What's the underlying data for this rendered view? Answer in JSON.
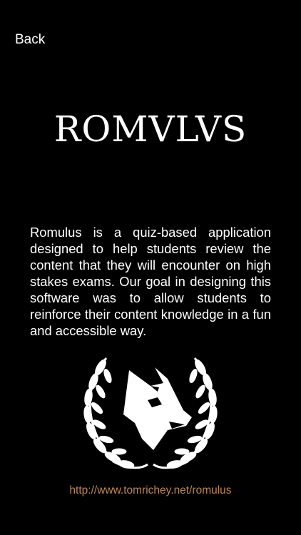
{
  "nav": {
    "back_label": "Back"
  },
  "app": {
    "title": "ROMVLVS",
    "description": "Romulus is a quiz-based application designed to help students review the content that they will encounter on high stakes exams. Our goal in designing this software was to allow students to reinforce their content knowledge in a fun and accessible way.",
    "website": "http://www.tomrichey.net/romulus",
    "emblem_icon": "wolf-laurel-wreath-icon"
  },
  "colors": {
    "background": "#000000",
    "text": "#ffffff",
    "link": "#b9865a"
  }
}
